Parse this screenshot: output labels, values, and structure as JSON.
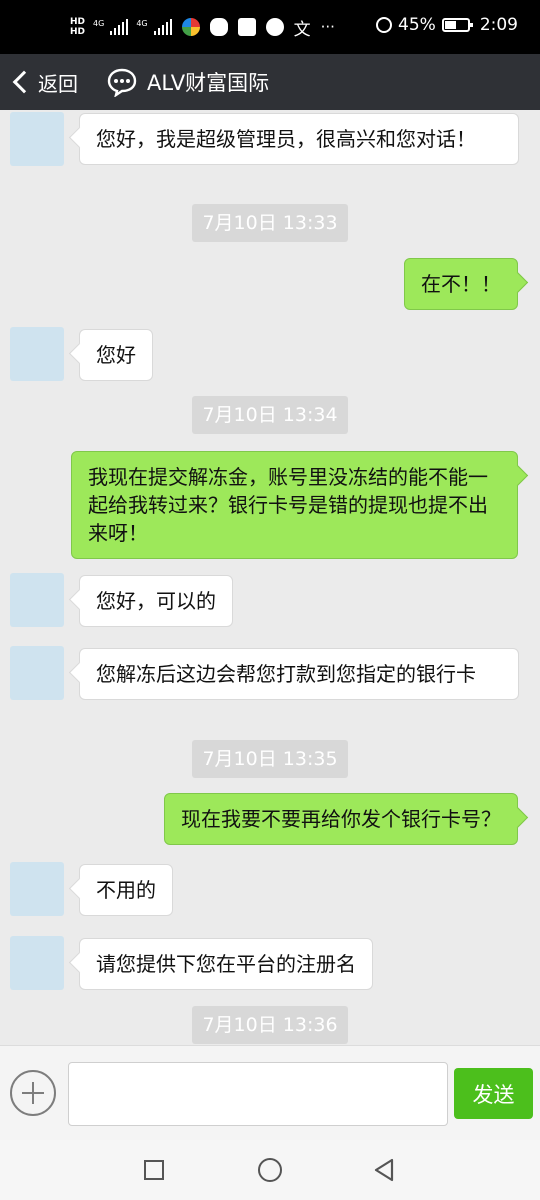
{
  "status_bar": {
    "hd1": "HD",
    "hd2": "HD",
    "net1": "4G",
    "net2": "4G",
    "battery": "45%",
    "time": "2:09",
    "more": "···",
    "mode_glyph": "文"
  },
  "header": {
    "back_label": "返回",
    "title": "ALV财富国际"
  },
  "messages": [
    {
      "type": "in",
      "text": "您好，我是超级管理员，很高兴和您对话！"
    },
    {
      "type": "time",
      "text": "7月10日 13:33"
    },
    {
      "type": "out",
      "text": "在不！！"
    },
    {
      "type": "in",
      "text": "您好"
    },
    {
      "type": "time",
      "text": "7月10日 13:34"
    },
    {
      "type": "out",
      "text": "我现在提交解冻金，账号里没冻结的能不能一起给我转过来？银行卡号是错的提现也提不出来呀！"
    },
    {
      "type": "in",
      "text": "您好，可以的"
    },
    {
      "type": "in",
      "text": "您解冻后这边会帮您打款到您指定的银行卡"
    },
    {
      "type": "time",
      "text": "7月10日 13:35"
    },
    {
      "type": "out",
      "text": "现在我要不要再给你发个银行卡号？"
    },
    {
      "type": "in",
      "text": "不用的"
    },
    {
      "type": "in",
      "text": "请您提供下您在平台的注册名"
    },
    {
      "type": "time",
      "text": "7月10日 13:36"
    }
  ],
  "input": {
    "placeholder": "",
    "send_label": "发送"
  },
  "colors": {
    "header_bg": "#2f3136",
    "chat_bg": "#ebebeb",
    "outgoing_bubble": "#9de85a",
    "send_button": "#4cbf1c"
  },
  "icons": {
    "back": "chevron-left-icon",
    "title": "chat-bubble-icon",
    "attach": "plus-circle-icon",
    "nav": [
      "square-icon",
      "circle-icon",
      "triangle-back-icon"
    ]
  }
}
